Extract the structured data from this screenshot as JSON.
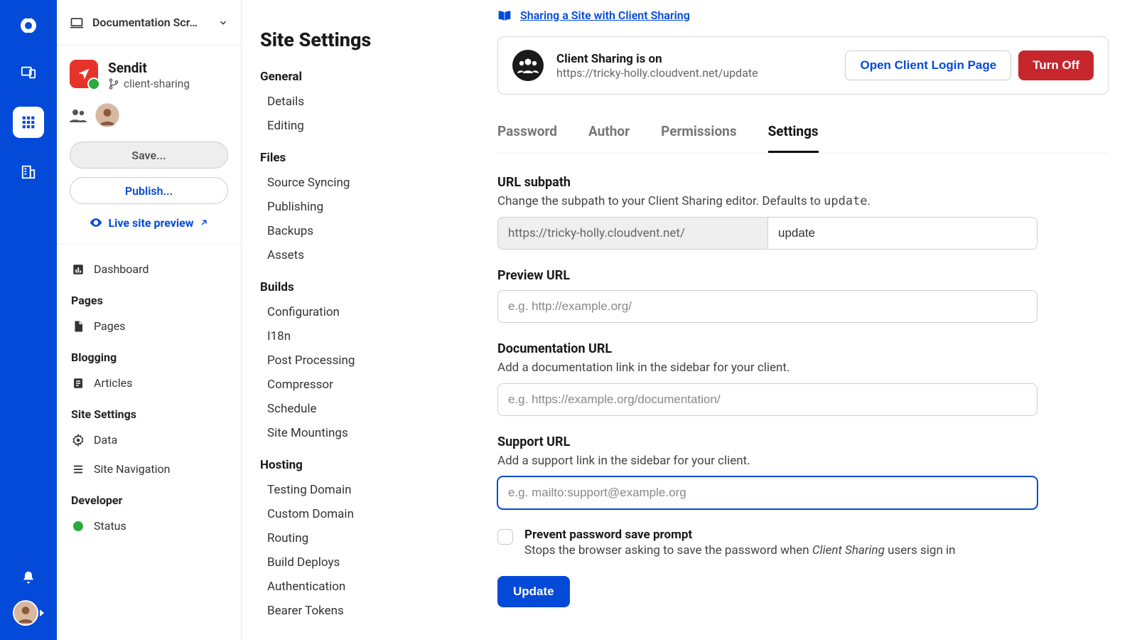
{
  "project_selector": "Documentation Scr…",
  "site": {
    "name": "Sendit",
    "branch": "client-sharing"
  },
  "buttons": {
    "save": "Save...",
    "publish": "Publish...",
    "live_preview": "Live site preview"
  },
  "nav": {
    "dashboard": "Dashboard",
    "headings": {
      "pages": "Pages",
      "blogging": "Blogging",
      "site_settings": "Site Settings",
      "developer": "Developer"
    },
    "pages": "Pages",
    "articles": "Articles",
    "data": "Data",
    "site_navigation": "Site Navigation",
    "status": "Status"
  },
  "settings_panel": {
    "title": "Site Settings",
    "groups": [
      {
        "heading": "General",
        "items": [
          "Details",
          "Editing"
        ]
      },
      {
        "heading": "Files",
        "items": [
          "Source Syncing",
          "Publishing",
          "Backups",
          "Assets"
        ]
      },
      {
        "heading": "Builds",
        "items": [
          "Configuration",
          "I18n",
          "Post Processing",
          "Compressor",
          "Schedule",
          "Site Mountings"
        ]
      },
      {
        "heading": "Hosting",
        "items": [
          "Testing Domain",
          "Custom Domain",
          "Routing",
          "Build Deploys",
          "Authentication",
          "Bearer Tokens"
        ]
      }
    ]
  },
  "main": {
    "help_link": "Sharing a Site with Client Sharing",
    "card": {
      "title": "Client Sharing is on",
      "subtitle": "https://tricky-holly.cloudvent.net/update",
      "open_btn": "Open Client Login Page",
      "turn_off_btn": "Turn Off"
    },
    "tabs": [
      "Password",
      "Author",
      "Permissions",
      "Settings"
    ],
    "active_tab": 3,
    "form": {
      "url_subpath": {
        "label": "URL subpath",
        "help_a": "Change the subpath to your Client Sharing editor. Defaults to ",
        "help_code": "update",
        "help_b": ".",
        "prefix": "https://tricky-holly.cloudvent.net/",
        "value": "update"
      },
      "preview_url": {
        "label": "Preview URL",
        "placeholder": "e.g. http://example.org/"
      },
      "doc_url": {
        "label": "Documentation URL",
        "help": "Add a documentation link in the sidebar for your client.",
        "placeholder": "e.g. https://example.org/documentation/"
      },
      "support_url": {
        "label": "Support URL",
        "help": "Add a support link in the sidebar for your client.",
        "placeholder": "e.g. mailto:support@example.org"
      },
      "checkbox": {
        "label": "Prevent password save prompt",
        "help_a": "Stops the browser asking to save the password when ",
        "help_em": "Client Sharing",
        "help_b": " users sign in"
      },
      "submit": "Update"
    }
  }
}
